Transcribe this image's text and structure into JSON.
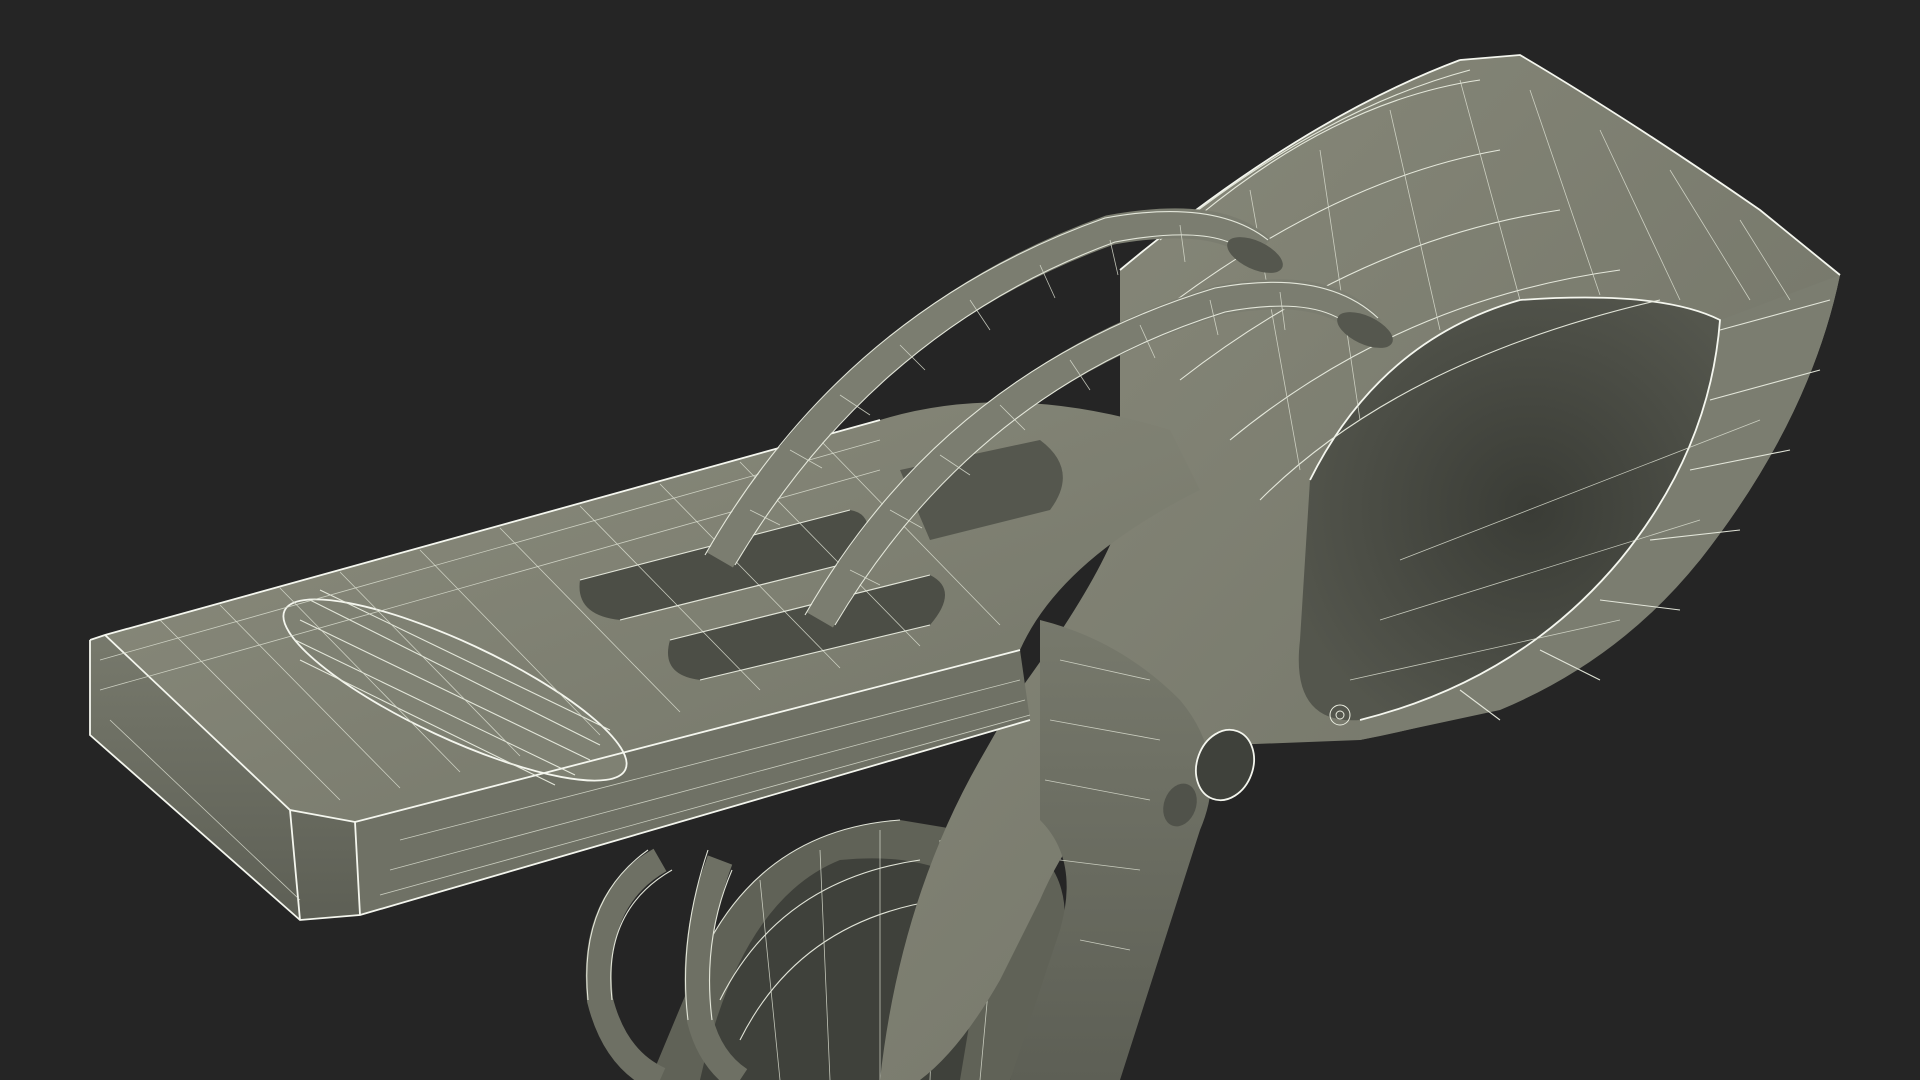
{
  "scene": {
    "subject": "clothespin-clip-wireframe",
    "colors": {
      "background": "#252525",
      "surface_light": "#868778",
      "surface_mid": "#74766a",
      "surface_dark": "#55574e",
      "interior": "#3f413b",
      "wire": "#e9ecdf"
    }
  }
}
